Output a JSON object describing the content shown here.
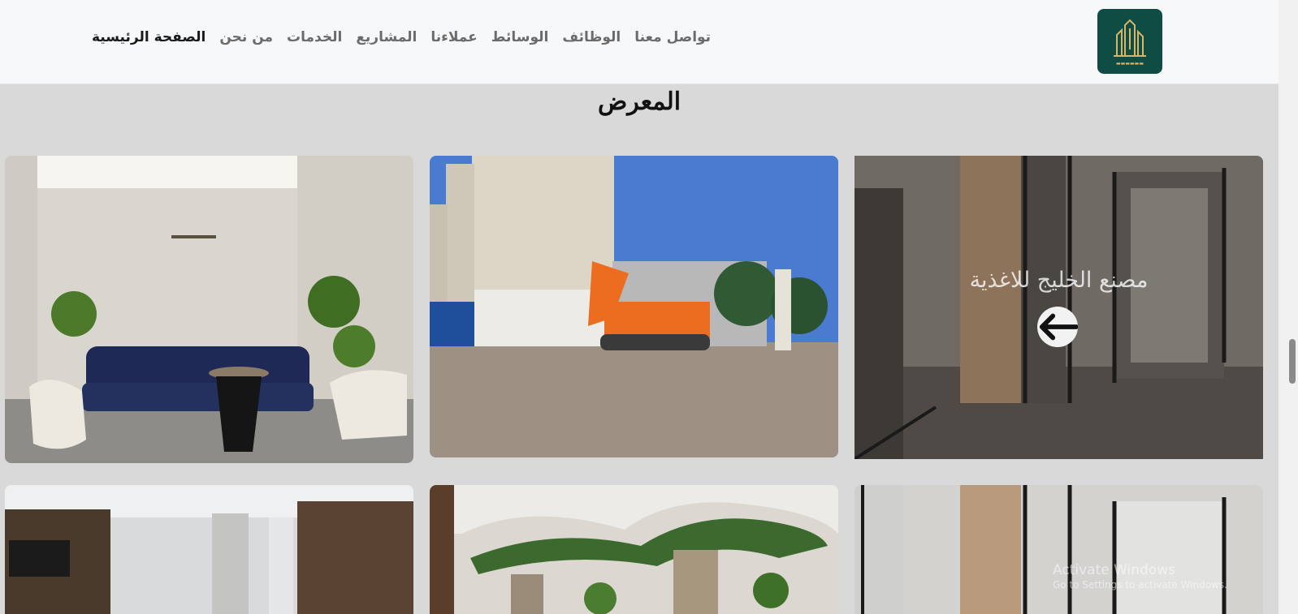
{
  "nav": {
    "items": [
      {
        "label": "الصفحة الرئيسية",
        "active": true
      },
      {
        "label": "من نحن"
      },
      {
        "label": "الخدمات"
      },
      {
        "label": "المشاريع"
      },
      {
        "label": "عملاءنا"
      },
      {
        "label": "الوسائط"
      },
      {
        "label": "الوظائف"
      },
      {
        "label": "تواصل معنا"
      }
    ]
  },
  "gallery": {
    "title": "المعرض",
    "overlay_caption": "مصنع الخليج للاغذية"
  },
  "colors": {
    "navbar_bg": "#f7f8fa",
    "page_bg": "#d9d9d9",
    "logo_bg": "#0f4c44",
    "logo_gold": "#d8b567"
  },
  "watermark": {
    "title": "Activate Windows",
    "subtitle": "Go to Settings to activate Windows."
  }
}
